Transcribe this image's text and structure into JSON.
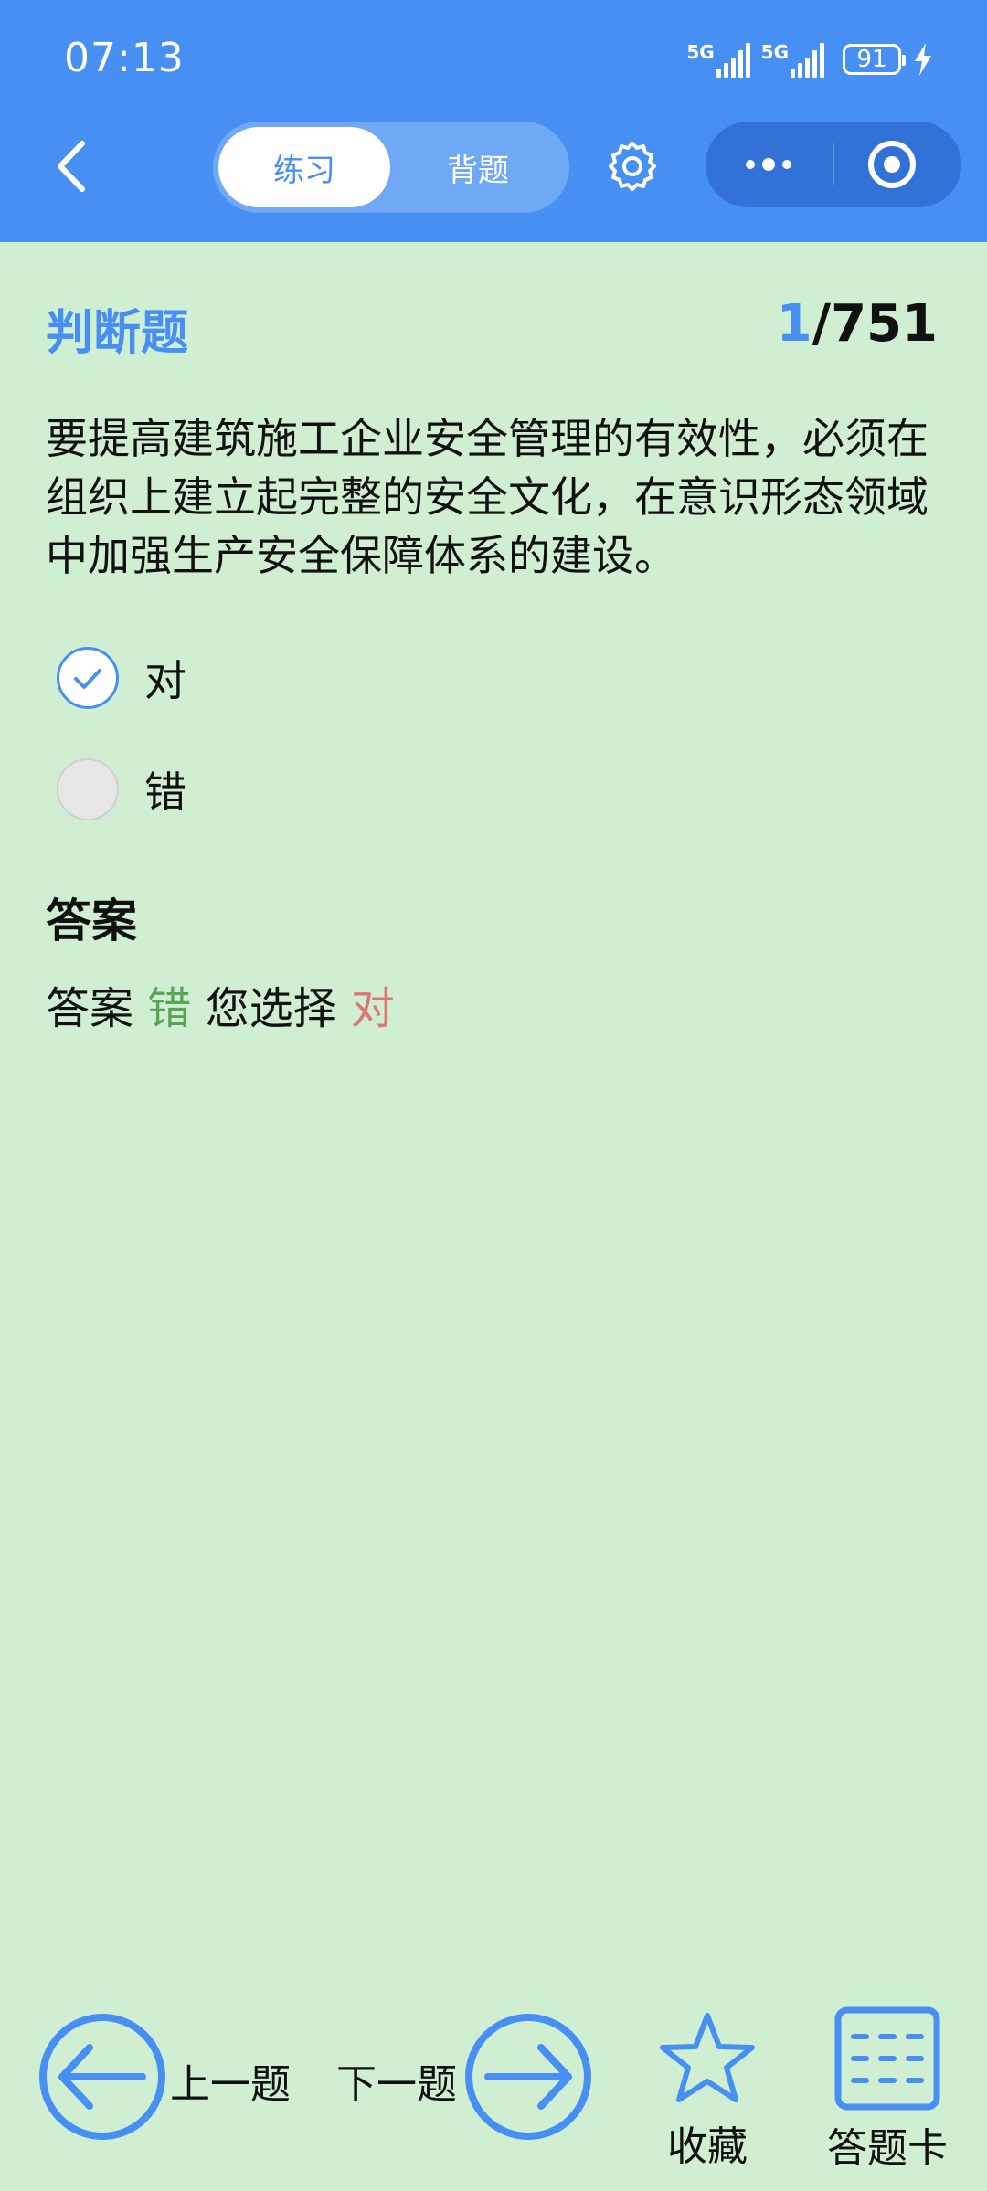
{
  "status": {
    "time": "07:13",
    "network1": "5G",
    "network2": "5G",
    "battery": "91"
  },
  "header": {
    "tabs": [
      {
        "label": "练习",
        "active": true
      },
      {
        "label": "背题",
        "active": false
      }
    ],
    "icons": {
      "back": "back-chevron-icon",
      "settings": "gear-icon",
      "more": "more-dots-icon",
      "target": "target-icon"
    }
  },
  "question": {
    "type": "判断题",
    "current": "1",
    "total_text": "/751",
    "text": "要提高建筑施工企业安全管理的有效性，必须在组织上建立起完整的安全文化，在意识形态领域中加强生产安全保障体系的建设。",
    "options": [
      {
        "label": "对",
        "checked": true
      },
      {
        "label": "错",
        "checked": false
      }
    ]
  },
  "answer": {
    "title": "答案",
    "prefix": "答案",
    "correct": "错",
    "chosen_prefix": "您选择",
    "chosen": "对"
  },
  "colors": {
    "primary": "#478ff3",
    "background": "#d0eed2",
    "correct": "#5aa45a",
    "wrong": "#e07575"
  },
  "bottom_nav": {
    "prev_label": "上一题",
    "next_label": "下一题",
    "favorite_label": "收藏",
    "answer_card_label": "答题卡"
  }
}
